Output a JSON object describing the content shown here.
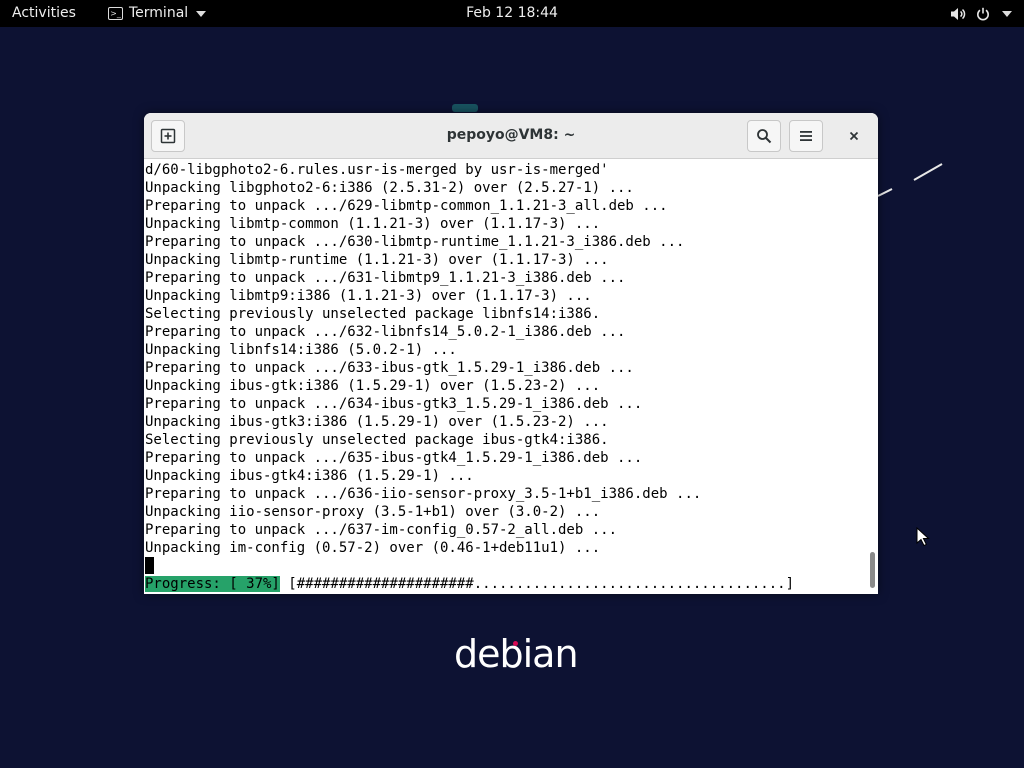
{
  "topbar": {
    "activities": "Activities",
    "app_menu_label": "Terminal",
    "app_menu_icon": "terminal-icon",
    "clock": "Feb 12  18:44",
    "tray_icons": [
      "volume-icon",
      "power-icon",
      "chevron-down-icon"
    ]
  },
  "window": {
    "title": "pepoyo@VM8: ~",
    "buttons": [
      "new-tab-icon",
      "search-icon",
      "hamburger-menu-icon",
      "close-icon"
    ]
  },
  "terminal": {
    "lines": [
      "d/60-libgphoto2-6.rules.usr-is-merged by usr-is-merged'",
      "Unpacking libgphoto2-6:i386 (2.5.31-2) over (2.5.27-1) ...",
      "Preparing to unpack .../629-libmtp-common_1.1.21-3_all.deb ...",
      "Unpacking libmtp-common (1.1.21-3) over (1.1.17-3) ...",
      "Preparing to unpack .../630-libmtp-runtime_1.1.21-3_i386.deb ...",
      "Unpacking libmtp-runtime (1.1.21-3) over (1.1.17-3) ...",
      "Preparing to unpack .../631-libmtp9_1.1.21-3_i386.deb ...",
      "Unpacking libmtp9:i386 (1.1.21-3) over (1.1.17-3) ...",
      "Selecting previously unselected package libnfs14:i386.",
      "Preparing to unpack .../632-libnfs14_5.0.2-1_i386.deb ...",
      "Unpacking libnfs14:i386 (5.0.2-1) ...",
      "Preparing to unpack .../633-ibus-gtk_1.5.29-1_i386.deb ...",
      "Unpacking ibus-gtk:i386 (1.5.29-1) over (1.5.23-2) ...",
      "Preparing to unpack .../634-ibus-gtk3_1.5.29-1_i386.deb ...",
      "Unpacking ibus-gtk3:i386 (1.5.29-1) over (1.5.23-2) ...",
      "Selecting previously unselected package ibus-gtk4:i386.",
      "Preparing to unpack .../635-ibus-gtk4_1.5.29-1_i386.deb ...",
      "Unpacking ibus-gtk4:i386 (1.5.29-1) ...",
      "Preparing to unpack .../636-iio-sensor-proxy_3.5-1+b1_i386.deb ...",
      "Unpacking iio-sensor-proxy (3.5-1+b1) over (3.0-2) ...",
      "Preparing to unpack .../637-im-config_0.57-2_all.deb ...",
      "Unpacking im-config (0.57-2) over (0.46-1+deb11u1) ..."
    ],
    "progress_label": "Progress: [ 37%]",
    "progress_bar": " [#####################.....................................]",
    "progress_fraction": 0.37,
    "accent_color": "#26a269"
  },
  "desktop": {
    "logo_text": "debian",
    "logo_dot_color": "#d70a53",
    "background_color": "#0d1233"
  }
}
